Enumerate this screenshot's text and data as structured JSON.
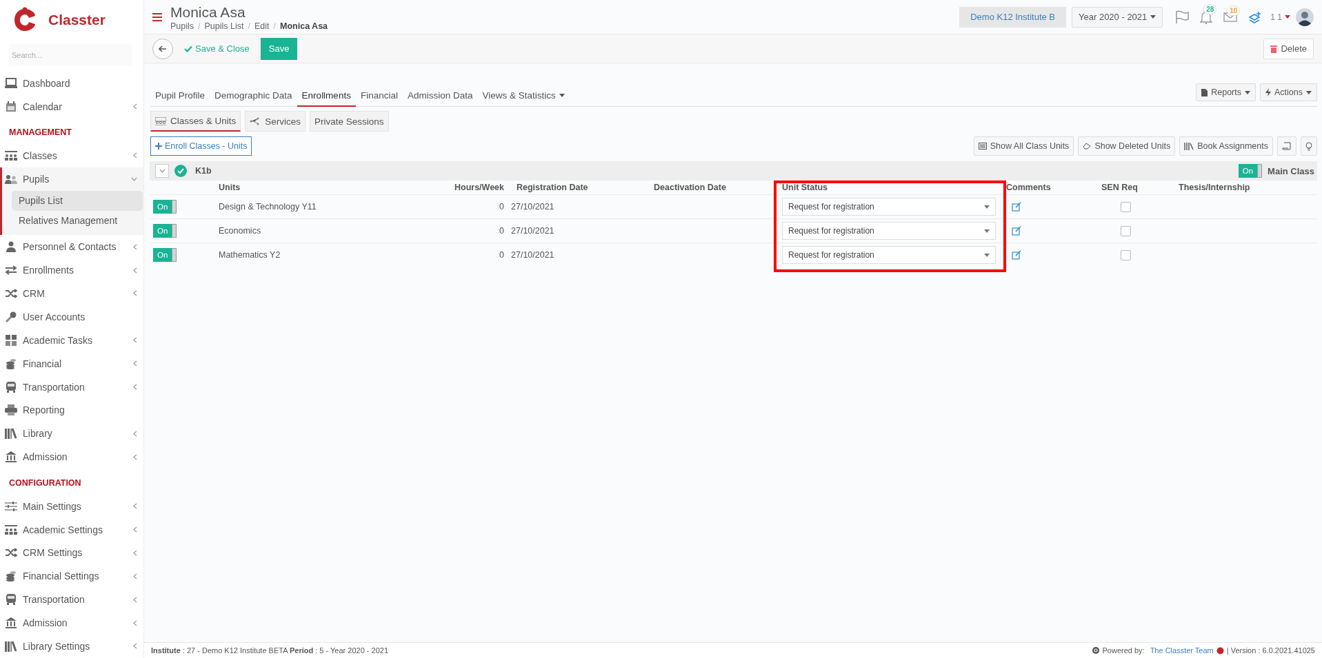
{
  "sidebar": {
    "logo_text": "Classter",
    "search": {
      "placeholder": "Search..."
    },
    "items": [
      {
        "kind": "item",
        "label": "Dashboard"
      },
      {
        "kind": "item",
        "label": "Calendar",
        "expanded": false
      },
      {
        "kind": "section",
        "label": "MANAGEMENT"
      },
      {
        "kind": "item",
        "label": "Classes",
        "expanded": false
      },
      {
        "kind": "item",
        "label": "Pupils",
        "expanded": true,
        "children": [
          {
            "label": "Pupils List",
            "selected": true
          },
          {
            "label": "Relatives Management",
            "selected": false
          }
        ]
      },
      {
        "kind": "item",
        "label": "Personnel & Contacts",
        "expanded": false
      },
      {
        "kind": "item",
        "label": "Enrollments",
        "expanded": false
      },
      {
        "kind": "item",
        "label": "CRM",
        "expanded": false
      },
      {
        "kind": "item",
        "label": "User Accounts"
      },
      {
        "kind": "item",
        "label": "Academic Tasks",
        "expanded": false
      },
      {
        "kind": "item",
        "label": "Financial",
        "expanded": false
      },
      {
        "kind": "item",
        "label": "Transportation",
        "expanded": false
      },
      {
        "kind": "item",
        "label": "Reporting"
      },
      {
        "kind": "item",
        "label": "Library",
        "expanded": false
      },
      {
        "kind": "item",
        "label": "Admission",
        "expanded": false
      },
      {
        "kind": "section",
        "label": "CONFIGURATION"
      },
      {
        "kind": "item",
        "label": "Main Settings",
        "expanded": false
      },
      {
        "kind": "item",
        "label": "Academic Settings",
        "expanded": false
      },
      {
        "kind": "item",
        "label": "CRM Settings",
        "expanded": false
      },
      {
        "kind": "item",
        "label": "Financial Settings",
        "expanded": false
      },
      {
        "kind": "item",
        "label": "Transportation",
        "expanded": false
      },
      {
        "kind": "item",
        "label": "Admission",
        "expanded": false
      },
      {
        "kind": "item",
        "label": "Library Settings",
        "expanded": false
      }
    ]
  },
  "header": {
    "title": "Monica Asa",
    "breadcrumbs": [
      "Pupils",
      "Pupils List",
      "Edit",
      "Monica Asa"
    ],
    "breadcrumb_separator": "/",
    "institute": "Demo K12 Institute B",
    "year": "Year 2020 - 2021",
    "notifications": [
      {
        "count": "28",
        "color": "#1ab394"
      },
      {
        "count": "10",
        "color": "#f0a33c"
      }
    ],
    "user": "1 1"
  },
  "toolbar": {
    "save_close": "Save & Close",
    "save": "Save",
    "delete": "Delete"
  },
  "tabs": [
    {
      "label": "Pupil Profile",
      "selected": false
    },
    {
      "label": "Demographic Data",
      "selected": false
    },
    {
      "label": "Enrollments",
      "selected": true
    },
    {
      "label": "Financial",
      "selected": false
    },
    {
      "label": "Admission Data",
      "selected": false
    },
    {
      "label": "Views & Statistics",
      "selected": false,
      "dropdown": true
    }
  ],
  "tab_actions": [
    "Reports",
    "Actions"
  ],
  "subtabs": [
    {
      "label": "Classes & Units",
      "selected": true
    },
    {
      "label": "Services",
      "selected": false
    },
    {
      "label": "Private Sessions",
      "selected": false
    }
  ],
  "enroll_button": "Enroll Classes - Units",
  "list_actions": [
    "Show All Class Units",
    "Show Deleted Units",
    "Book Assignments"
  ],
  "group": {
    "name": "K1b",
    "expanded": true,
    "main_class": {
      "on": true,
      "toggle": "On",
      "label": "Main Class"
    }
  },
  "table": {
    "columns": [
      {
        "label": "Units",
        "highlighted": false
      },
      {
        "label": "Hours/Week",
        "highlighted": false
      },
      {
        "label": "Registration Date",
        "highlighted": false
      },
      {
        "label": "Deactivation Date",
        "highlighted": false
      },
      {
        "label": "Unit Status",
        "highlighted": true
      },
      {
        "label": "Comments",
        "highlighted": false
      },
      {
        "label": "SEN Req",
        "highlighted": false
      },
      {
        "label": "Thesis/Internship",
        "highlighted": false
      }
    ],
    "rows": [
      {
        "on": true,
        "toggle": "On",
        "unit": "Design & Technology Y11",
        "hours": "0",
        "registration": "27/10/2021",
        "status": "Request for registration",
        "sen_req": false
      },
      {
        "on": true,
        "toggle": "On",
        "unit": "Economics",
        "hours": "0",
        "registration": "27/10/2021",
        "status": "Request for registration",
        "sen_req": false
      },
      {
        "on": true,
        "toggle": "On",
        "unit": "Mathematics Y2",
        "hours": "0",
        "registration": "27/10/2021",
        "status": "Request for registration",
        "sen_req": false
      }
    ]
  },
  "footer": {
    "info": "**Institute** : 27 - Demo K12 Institute BETA **Period** : 5 - Year 2020 - 2021",
    "powered": "Powered by:",
    "team": "The Classter Team",
    "version": "| Version : 6.0.2021.41025"
  }
}
